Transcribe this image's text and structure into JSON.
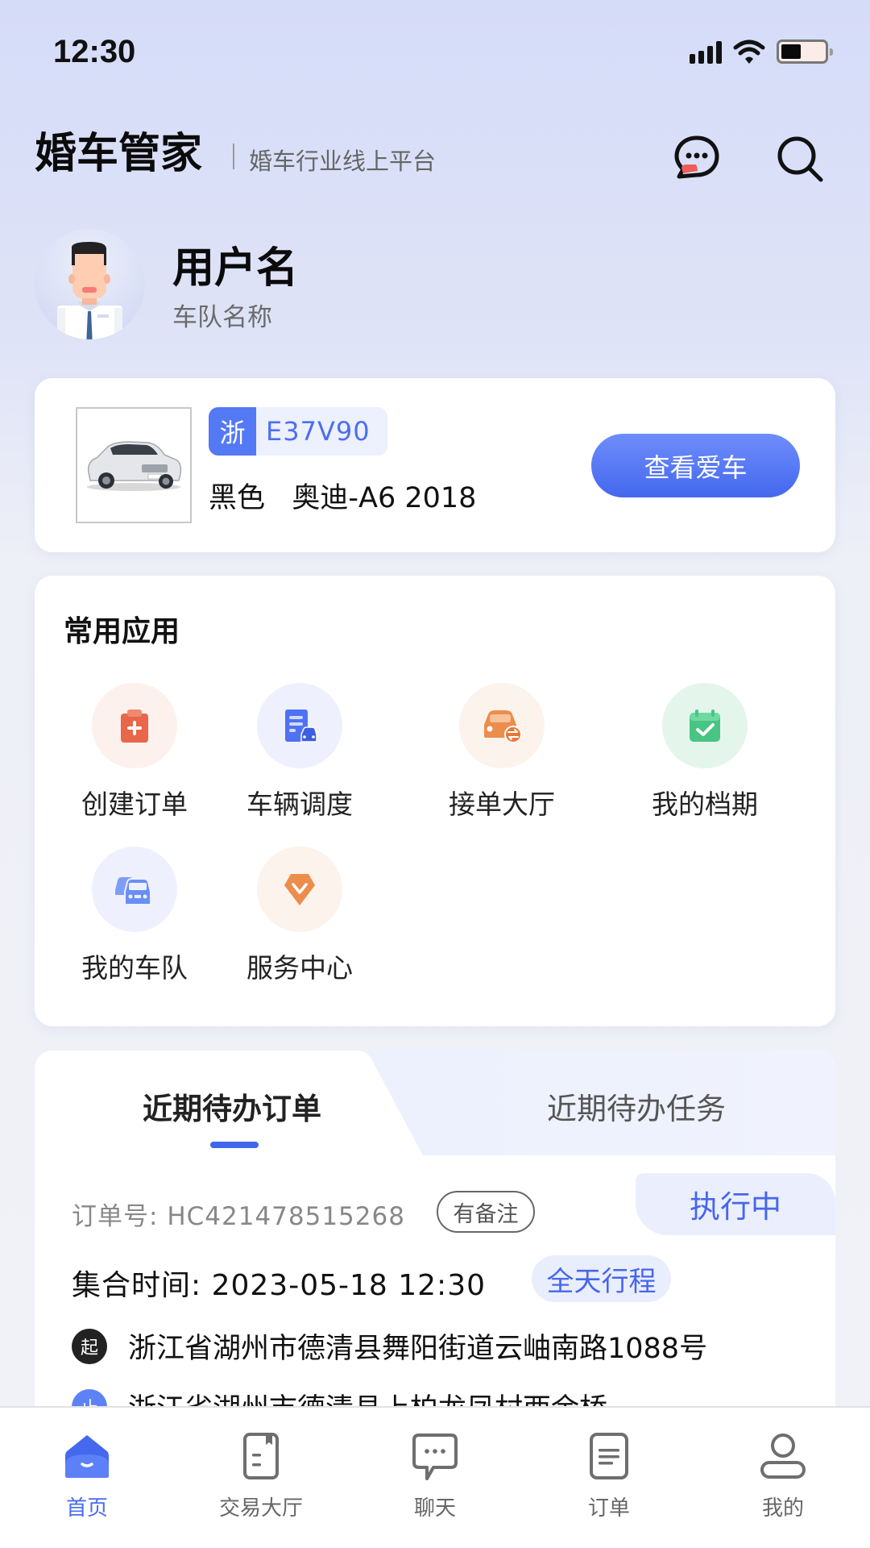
{
  "status_bar": {
    "time": "12:30",
    "battery_level": 0.4
  },
  "header": {
    "title": "婚车管家",
    "subtitle": "婚车行业线上平台",
    "icons": [
      "message-icon",
      "search-icon"
    ]
  },
  "user": {
    "name": "用户名",
    "team": "车队名称"
  },
  "car": {
    "plate_province": "浙",
    "plate_number": "E37V90",
    "color": "黑色",
    "model": "奥迪-A6 2018",
    "view_button": "查看爱车"
  },
  "apps": {
    "title": "常用应用",
    "items": [
      {
        "label": "创建订单",
        "icon": "clipboard-plus-icon",
        "color": "#e8664a",
        "bg": "#fcf1ec"
      },
      {
        "label": "车辆调度",
        "icon": "document-car-icon",
        "color": "#4f72f3",
        "bg": "#eef1fd"
      },
      {
        "label": "接单大厅",
        "icon": "car-exchange-icon",
        "color": "#ec8d4c",
        "bg": "#fcf3ec"
      },
      {
        "label": "我的档期",
        "icon": "calendar-check-icon",
        "color": "#48c583",
        "bg": "#e4f6ec"
      },
      {
        "label": "我的车队",
        "icon": "car-fleet-icon",
        "color": "#6a8ef6",
        "bg": "#eef1fd"
      },
      {
        "label": "服务中心",
        "icon": "diamond-service-icon",
        "color": "#ec8d4c",
        "bg": "#fcf3ec"
      }
    ]
  },
  "orders": {
    "tabs": [
      {
        "label": "近期待办订单",
        "active": true
      },
      {
        "label": "近期待办任务",
        "active": false
      }
    ],
    "order": {
      "number_label": "订单号:",
      "number": "HC421478515268",
      "note_badge": "有备注",
      "status": "执行中",
      "gather_label": "集合时间:",
      "gather_time": "2023-05-18 12:30",
      "trip_badge": "全天行程",
      "stops": [
        {
          "marker": "起",
          "address": "浙江省湖州市德清县舞阳街道云岫南路1088号",
          "color": "#222222"
        },
        {
          "marker": "止",
          "address": "浙江省湖州市德清县上柏龙凤村西余桥",
          "color": "#5d82f6"
        }
      ]
    }
  },
  "tabbar": {
    "accent": "#4a6cf0",
    "items": [
      {
        "label": "首页",
        "icon": "home-icon",
        "active": true
      },
      {
        "label": "交易大厅",
        "icon": "bookmark-doc-icon",
        "active": false
      },
      {
        "label": "聊天",
        "icon": "chat-bubble-icon",
        "active": false
      },
      {
        "label": "订单",
        "icon": "order-list-icon",
        "active": false
      },
      {
        "label": "我的",
        "icon": "user-icon",
        "active": false
      }
    ]
  }
}
